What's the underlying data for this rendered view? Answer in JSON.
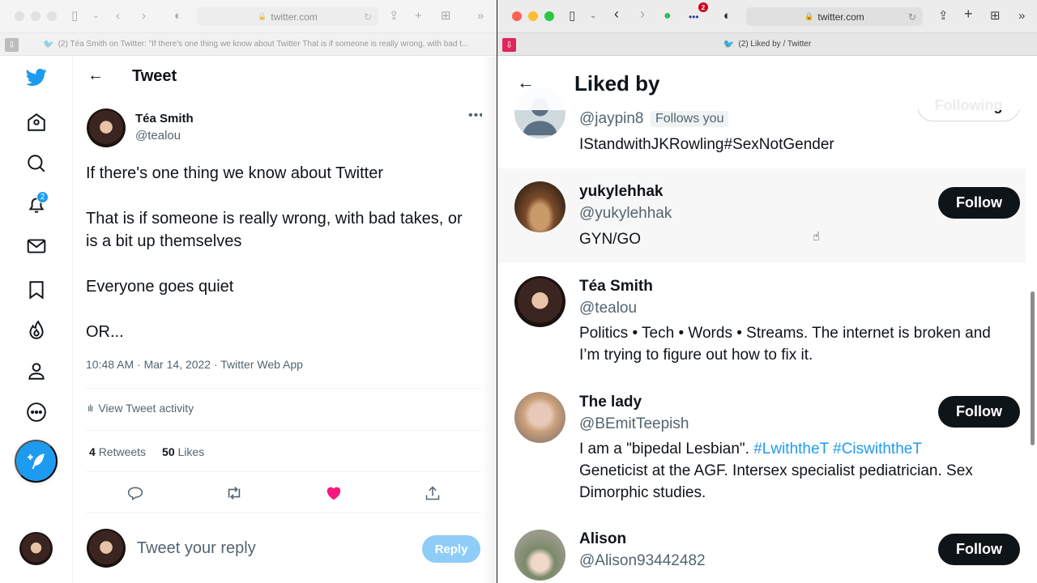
{
  "left_window": {
    "url": "twitter.com",
    "tab_title": "(2) Téa Smith on Twitter: \"If there's one thing we know about Twitter That is if someone is really wrong, with bad t...",
    "sidebar": {
      "items": [
        {
          "name": "twitter-logo"
        },
        {
          "name": "home"
        },
        {
          "name": "explore"
        },
        {
          "name": "notifications",
          "badge": "2"
        },
        {
          "name": "messages"
        },
        {
          "name": "bookmarks"
        },
        {
          "name": "topics"
        },
        {
          "name": "profile"
        },
        {
          "name": "more"
        }
      ],
      "compose_label": "Tweet"
    },
    "header": {
      "title": "Tweet"
    },
    "tweet": {
      "author_name": "Téa Smith",
      "author_handle": "@tealou",
      "paragraphs": [
        "If there's one thing we know about Twitter",
        "That is if someone is really wrong, with bad takes, or is a bit up themselves",
        "Everyone goes quiet",
        "OR..."
      ],
      "meta": "10:48 AM · Mar 14, 2022 · Twitter Web App",
      "activity_label": "View Tweet activity",
      "retweets_count": "4",
      "retweets_label": "Retweets",
      "likes_count": "50",
      "likes_label": "Likes",
      "liked": true,
      "like_color": "#f91880"
    },
    "reply": {
      "placeholder": "Tweet your reply",
      "button": "Reply"
    }
  },
  "right_window": {
    "url": "twitter.com",
    "tab_title": "(2) Liked by / Twitter",
    "extension_badge": "2",
    "header": {
      "title": "Liked by"
    },
    "users": [
      {
        "name": "",
        "handle": "@jaypin8",
        "follows_you": "Follows you",
        "bio": "IStandwithJKRowling#SexNotGender",
        "button": "Following"
      },
      {
        "name": "yukylehhak",
        "handle": "@yukylehhak",
        "bio": "GYN/GO",
        "button": "Follow"
      },
      {
        "name": "Téa Smith",
        "handle": "@tealou",
        "bio": "Politics • Tech • Words • Streams. The internet is broken and I’m trying to figure out how to fix it.",
        "button": ""
      },
      {
        "name": "The lady",
        "handle": "@BEmitTeepish",
        "bio_prefix": "I am a \"bipedal Lesbian\". ",
        "bio_tags": [
          "#LwiththeT",
          "#CiswiththeT"
        ],
        "bio_suffix": "Geneticist at the AGF. Intersex specialist pediatrician. Sex Dimorphic studies.",
        "button": "Follow"
      },
      {
        "name": "Alison",
        "handle": "@Alison93442482",
        "bio": "",
        "button": "Follow"
      }
    ]
  },
  "colors": {
    "accent": "#1d9bf0",
    "text": "#0f1419",
    "secondary": "#536471",
    "follow_bg": "#0f1419"
  }
}
